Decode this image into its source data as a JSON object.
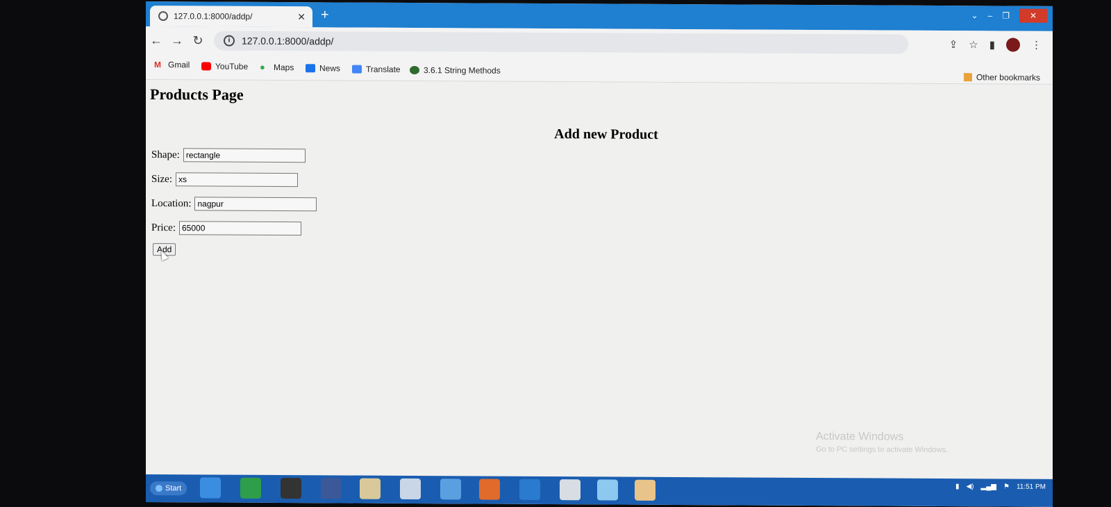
{
  "browser": {
    "tab_title": "127.0.0.1:8000/addp/",
    "address": "127.0.0.1:8000/addp/"
  },
  "bookmarks": [
    {
      "label": "Gmail",
      "icon": "gmail-icon",
      "color": "#d93025"
    },
    {
      "label": "YouTube",
      "icon": "youtube-icon",
      "color": "#ff0000"
    },
    {
      "label": "Maps",
      "icon": "maps-icon",
      "color": "#34a853"
    },
    {
      "label": "News",
      "icon": "news-icon",
      "color": "#1a73e8"
    },
    {
      "label": "Translate",
      "icon": "translate-icon",
      "color": "#4285f4"
    },
    {
      "label": "3.6.1 String Methods",
      "icon": "python-icon",
      "color": "#2e6b2e"
    }
  ],
  "other_bookmarks": "Other bookmarks",
  "page": {
    "title": "Products Page",
    "form_heading": "Add new Product",
    "fields": [
      {
        "label": "Shape:",
        "value": "rectangle"
      },
      {
        "label": "Size:",
        "value": "xs"
      },
      {
        "label": "Location:",
        "value": "nagpur"
      },
      {
        "label": "Price:",
        "value": "65000"
      }
    ],
    "submit_label": "Add"
  },
  "watermark": {
    "line1": "Activate Windows",
    "line2": "Go to PC settings to activate Windows."
  },
  "taskbar": {
    "start_label": "Start",
    "clock": "11:51 PM"
  }
}
